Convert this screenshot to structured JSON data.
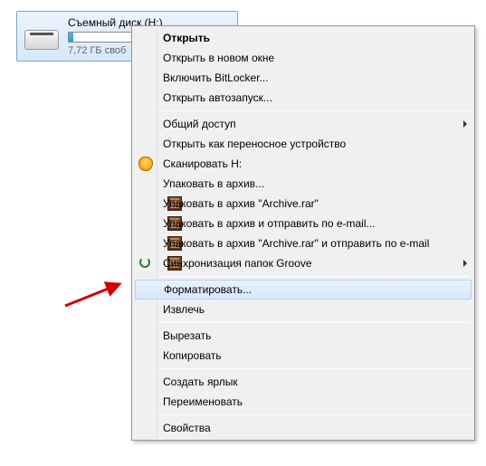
{
  "drive": {
    "title": "Съемный диск (H:)",
    "subtitle": "7,72 ГБ своб",
    "fill_percent": 3
  },
  "menu": {
    "items": [
      {
        "label": "Открыть",
        "bold": true
      },
      {
        "label": "Открыть в новом окне"
      },
      {
        "label": "Включить BitLocker..."
      },
      {
        "label": "Открыть автозапуск..."
      },
      {
        "sep": true
      },
      {
        "label": "Общий доступ",
        "submenu": true
      },
      {
        "label": "Открыть как переносное устройство"
      },
      {
        "label": "Сканировать H:",
        "icon": "shield"
      },
      {
        "label": "Упаковать в архив...",
        "icon": "archive"
      },
      {
        "label": "Упаковать в архив \"Archive.rar\"",
        "icon": "archive"
      },
      {
        "label": "Упаковать в архив и отправить по e-mail...",
        "icon": "archive"
      },
      {
        "label": "Упаковать в архив \"Archive.rar\" и отправить по e-mail",
        "icon": "archive"
      },
      {
        "label": "Синхронизация папок Groove",
        "icon": "sync",
        "submenu": true
      },
      {
        "sep": true
      },
      {
        "label": "Форматировать...",
        "highlight": true
      },
      {
        "label": "Извлечь"
      },
      {
        "sep": true
      },
      {
        "label": "Вырезать"
      },
      {
        "label": "Копировать"
      },
      {
        "sep": true
      },
      {
        "label": "Создать ярлык"
      },
      {
        "label": "Переименовать"
      },
      {
        "sep": true
      },
      {
        "label": "Свойства"
      }
    ]
  }
}
